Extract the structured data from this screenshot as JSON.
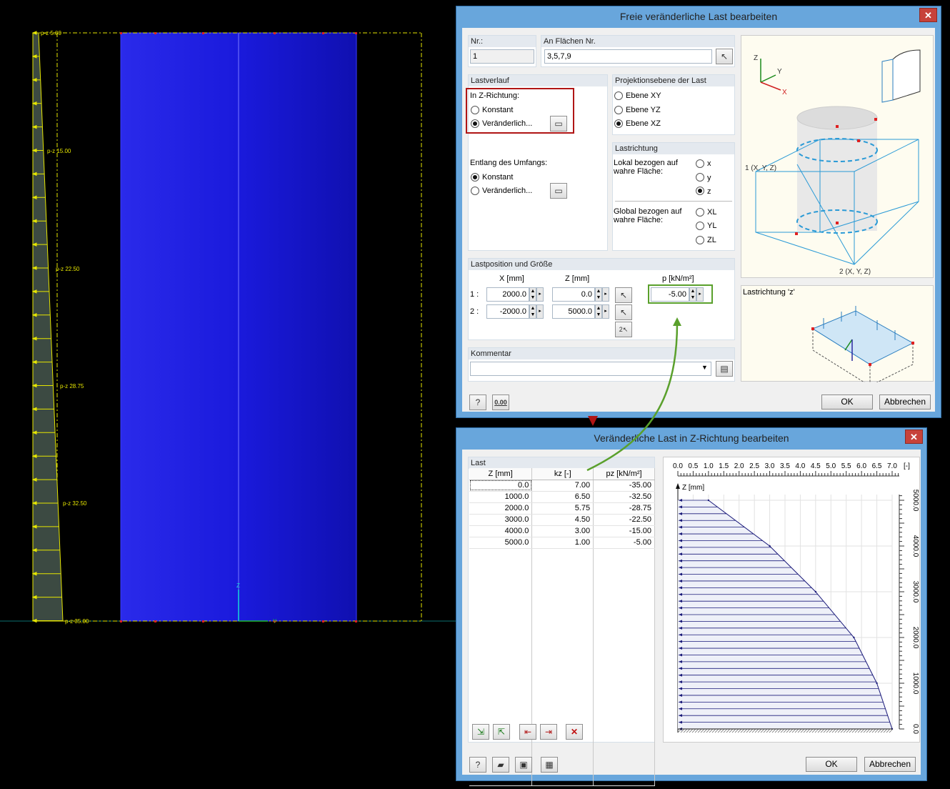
{
  "model": {
    "labels": [
      "p-z 5.00",
      "p-z 15.00",
      "p-z 22.50",
      "p-z 28.75",
      "p-z 32.50",
      "p-z 35.00"
    ],
    "axis_z": "Z",
    "axis_y": "Y"
  },
  "dialog1": {
    "title": "Freie veränderliche Last bearbeiten",
    "close": "✕",
    "nr_label": "Nr.:",
    "nr_value": "1",
    "flaechen_label": "An Flächen Nr.",
    "flaechen_value": "3,5,7,9",
    "lastverlauf_label": "Lastverlauf",
    "z_richtung_label": "In Z-Richtung:",
    "konstant": "Konstant",
    "veraenderlich": "Veränderlich...",
    "umfang_label": "Entlang des Umfangs:",
    "umfang_konstant": "Konstant",
    "umfang_veraenderlich": "Veränderlich...",
    "projektion_label": "Projektionsebene der Last",
    "ebene_xy": "Ebene XY",
    "ebene_yz": "Ebene YZ",
    "ebene_xz": "Ebene XZ",
    "lastrichtung_label": "Lastrichtung",
    "lokal_label": "Lokal bezogen auf wahre Fläche:",
    "lokal_x": "x",
    "lokal_y": "y",
    "lokal_z": "z",
    "global_label": "Global bezogen auf wahre Fläche:",
    "global_xl": "XL",
    "global_yl": "YL",
    "global_zl": "ZL",
    "lastposition_label": "Lastposition und Größe",
    "col_x": "X [mm]",
    "col_z": "Z [mm]",
    "col_p": "p [kN/m²]",
    "row1_label": "1 :",
    "row2_label": "2 :",
    "row1_x": "2000.0",
    "row1_z": "0.0",
    "row2_x": "-2000.0",
    "row2_z": "5000.0",
    "p_value": "-5.00",
    "kommentar_label": "Kommentar",
    "kommentar_value": "",
    "preview_p1": "1 (X, Y, Z)",
    "preview_p2": "2 (X, Y, Z)",
    "preview_axis_z": "Z",
    "preview_axis_y": "Y",
    "preview_axis_x": "X",
    "lastrichtung_preview": "Lastrichtung 'z'",
    "ok": "OK",
    "abbrechen": "Abbrechen",
    "units_btn": "0.00"
  },
  "dialog2": {
    "title": "Veränderliche Last in Z-Richtung bearbeiten",
    "close": "✕",
    "last_label": "Last",
    "col_z": "Z [mm]",
    "col_kz": "kz [-]",
    "col_pz": "pz [kN/m²]",
    "rows": [
      {
        "z": "0.0",
        "kz": "7.00",
        "pz": "-35.00"
      },
      {
        "z": "1000.0",
        "kz": "6.50",
        "pz": "-32.50"
      },
      {
        "z": "2000.0",
        "kz": "5.75",
        "pz": "-28.75"
      },
      {
        "z": "3000.0",
        "kz": "4.50",
        "pz": "-22.50"
      },
      {
        "z": "4000.0",
        "kz": "3.00",
        "pz": "-15.00"
      },
      {
        "z": "5000.0",
        "kz": "1.00",
        "pz": "-5.00"
      }
    ],
    "chart_axis_label": "Z [mm]",
    "chart_unit": "[-]",
    "ok": "OK",
    "abbrechen": "Abbrechen"
  },
  "chart_data": {
    "type": "area",
    "x": [
      0,
      1000,
      2000,
      3000,
      4000,
      5000
    ],
    "values": [
      7.0,
      6.5,
      5.75,
      4.5,
      3.0,
      1.0
    ],
    "xlabel": "Z [mm]",
    "ylabel": "[-]",
    "kz_ticks": [
      "0.0",
      "0.5",
      "1.0",
      "1.5",
      "2.0",
      "2.5",
      "3.0",
      "3.5",
      "4.0",
      "4.5",
      "5.0",
      "5.5",
      "6.0",
      "6.5",
      "7.0"
    ],
    "z_ticks": [
      "0.0",
      "1000.0",
      "2000.0",
      "3000.0",
      "4000.0",
      "5000.0"
    ],
    "ylim": [
      0,
      7.0
    ],
    "xlim": [
      0,
      5000
    ]
  },
  "colors": {
    "surface": "#1a1ad6",
    "load_line": "#e6e600",
    "dialog_frame": "#68a6dc",
    "highlight_red": "#b01515",
    "highlight_green": "#5aa02c"
  }
}
